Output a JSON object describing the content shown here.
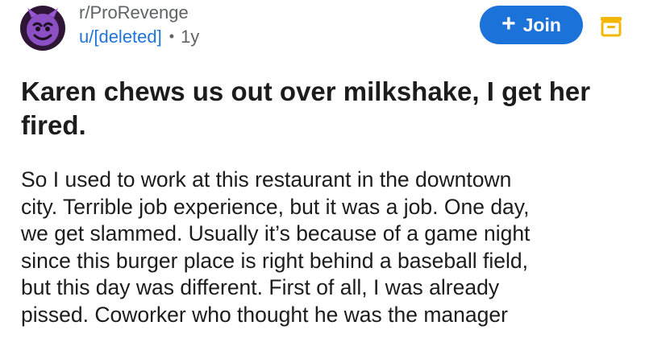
{
  "post": {
    "subreddit": "r/ProRevenge",
    "author": "u/[deleted]",
    "separator": "•",
    "age": "1y",
    "join_label": "Join",
    "title": "Karen chews us out over milkshake, I get her fired.",
    "body_lines": [
      "So I used to work at this restaurant in the downtown",
      "city. Terrible job experience, but it was a job. One day,",
      "we get slammed. Usually it’s because of a game night",
      "since this burger place is right behind a baseball field,",
      "but this day was different. First of all, I was already",
      "pissed. Coworker who thought he was the manager"
    ]
  },
  "icons": {
    "avatar": "devil-face-icon",
    "join": "plus-icon",
    "save": "save-icon"
  },
  "colors": {
    "accent": "#1b72d9",
    "avatar_purple": "#8c4fc4",
    "save_yellow": "#f2b705",
    "author_link": "#1f74d6"
  }
}
